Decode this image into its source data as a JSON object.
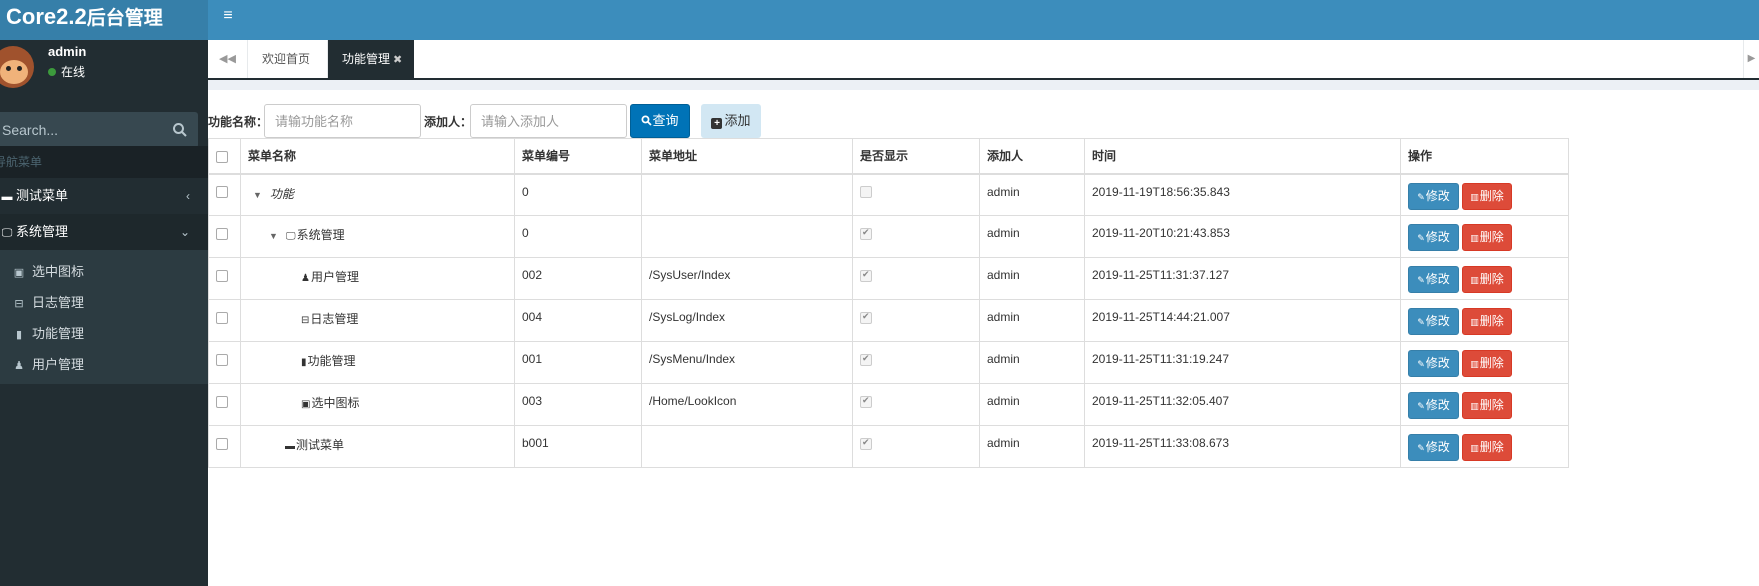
{
  "header": {
    "logo_main": "Core2.2",
    "logo_suffix": "后台管理",
    "toggle_icon": "bars-icon"
  },
  "sidebar": {
    "user": {
      "name": "admin",
      "status": "在线"
    },
    "search": {
      "placeholder": "Search..."
    },
    "nav_header": "导航菜单",
    "menus": [
      {
        "label": "测试菜单",
        "icon": "credit-card-icon"
      },
      {
        "label": "系统管理",
        "icon": "desktop-icon"
      }
    ],
    "submenu": [
      {
        "label": "选中图标",
        "icon": "image-icon"
      },
      {
        "label": "日志管理",
        "icon": "basket-icon"
      },
      {
        "label": "功能管理",
        "icon": "book-icon"
      },
      {
        "label": "用户管理",
        "icon": "user-icon"
      }
    ]
  },
  "tabs": [
    {
      "label": "欢迎首页"
    },
    {
      "label": "功能管理",
      "close": "✖"
    }
  ],
  "filter": {
    "name_label": "功能名称：",
    "name_placeholder": "请输功能名称",
    "adder_label": "添加人：",
    "adder_placeholder": "请输入添加人",
    "query_label": "查询",
    "add_label": "添加"
  },
  "table": {
    "headers": [
      "菜单名称",
      "菜单编号",
      "菜单地址",
      "是否显示",
      "添加人",
      "时间",
      "操作"
    ],
    "edit_label": "修改",
    "delete_label": "删除",
    "rows": [
      {
        "name": "功能",
        "code": "0",
        "url": "",
        "show": false,
        "adder": "admin",
        "time": "2019-11-19T18:56:35.843"
      },
      {
        "name": "系统管理",
        "code": "0",
        "url": "",
        "show": true,
        "adder": "admin",
        "time": "2019-11-20T10:21:43.853"
      },
      {
        "name": "用户管理",
        "code": "002",
        "url": "/SysUser/Index",
        "show": true,
        "adder": "admin",
        "time": "2019-11-25T11:31:37.127"
      },
      {
        "name": "日志管理",
        "code": "004",
        "url": "/SysLog/Index",
        "show": true,
        "adder": "admin",
        "time": "2019-11-25T14:44:21.007"
      },
      {
        "name": "功能管理",
        "code": "001",
        "url": "/SysMenu/Index",
        "show": true,
        "adder": "admin",
        "time": "2019-11-25T11:31:19.247"
      },
      {
        "name": "选中图标",
        "code": "003",
        "url": "/Home/LookIcon",
        "show": true,
        "adder": "admin",
        "time": "2019-11-25T11:32:05.407"
      },
      {
        "name": "测试菜单",
        "code": "b001",
        "url": "",
        "show": true,
        "adder": "admin",
        "time": "2019-11-25T11:33:08.673"
      }
    ]
  }
}
